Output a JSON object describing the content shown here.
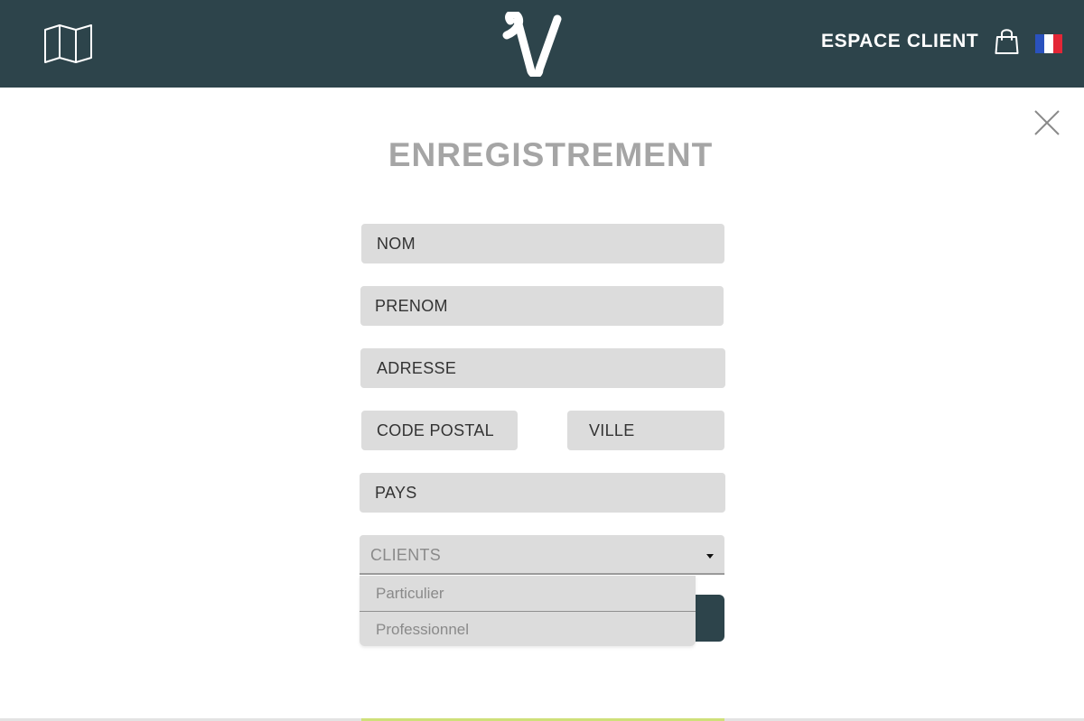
{
  "header": {
    "logo_icon": "v-logo-icon",
    "map_icon": "map-icon",
    "espace_client_label": "ESPACE CLIENT",
    "bag_icon": "shopping-bag-icon",
    "flag_icon": "flag-fr-icon",
    "language": "FR"
  },
  "modal": {
    "close_icon": "close-icon",
    "title": "ENREGISTREMENT"
  },
  "form": {
    "nom_placeholder": "NOM",
    "prenom_placeholder": "PRENOM",
    "adresse_placeholder": "ADRESSE",
    "code_postal_placeholder": "CODE POSTAL",
    "ville_placeholder": "VILLE",
    "pays_placeholder": "PAYS",
    "clients_select": {
      "selected_label": "CLIENTS",
      "options": [
        "Particulier",
        "Professionnel"
      ]
    }
  },
  "colors": {
    "header_bg": "#2d444b",
    "field_bg": "#dcdcdc",
    "title": "#a5a5a5",
    "button_bg": "#2d444b"
  }
}
